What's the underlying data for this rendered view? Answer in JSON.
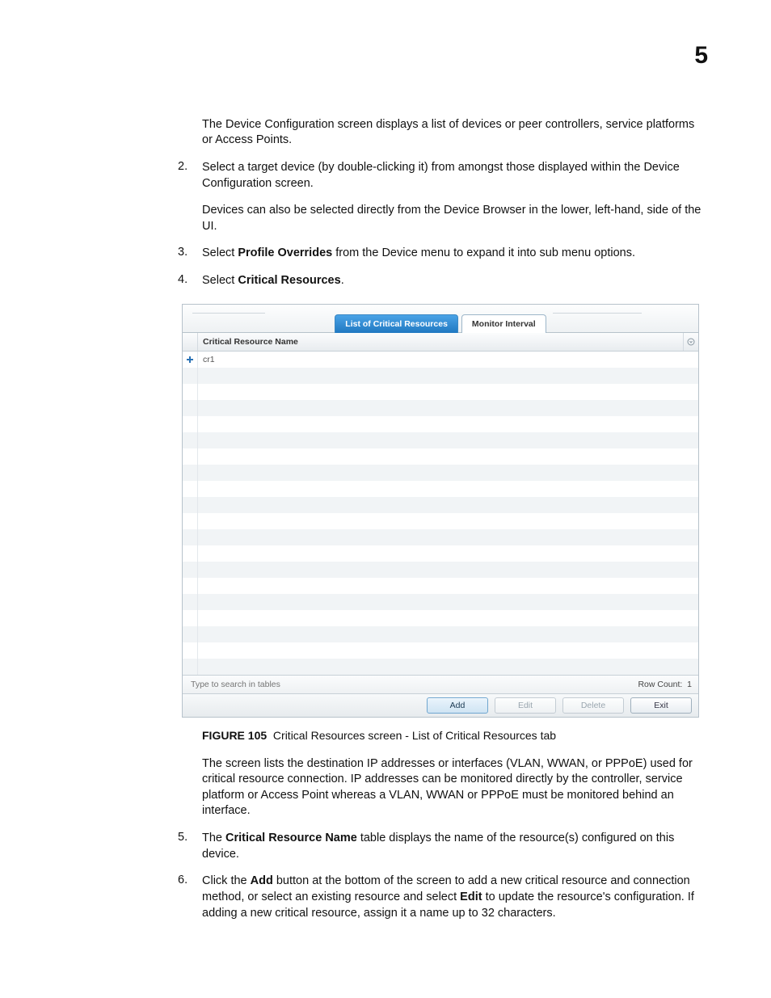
{
  "page_number": "5",
  "paragraphs": {
    "intro": "The Device Configuration screen displays a list of devices or peer controllers, service platforms or Access Points.",
    "step2": "Select a target device (by double-clicking it) from amongst those displayed within the Device Configuration screen.",
    "step2b": "Devices can also be selected directly from the Device Browser in the lower, left-hand, side of the UI.",
    "step3_pre": "Select ",
    "step3_bold": "Profile Overrides",
    "step3_post": " from the Device menu to expand it into sub menu options.",
    "step4_pre": "Select ",
    "step4_bold": "Critical Resources",
    "step4_post": ".",
    "after_fig": "The screen lists the destination IP addresses or interfaces (VLAN, WWAN, or PPPoE) used for critical resource connection. IP addresses can be monitored directly by the controller, service platform or Access Point whereas a VLAN, WWAN or PPPoE must be monitored behind an interface.",
    "step5_pre": "The ",
    "step5_bold": "Critical Resource Name",
    "step5_post": " table displays the name of the resource(s) configured on this device.",
    "step6_pre": "Click the ",
    "step6_bold1": "Add",
    "step6_mid": " button at the bottom of the screen to add a new critical resource and connection method, or select an existing resource and select ",
    "step6_bold2": "Edit",
    "step6_post": " to update the resource's configuration. If adding a new critical resource, assign it a name up to 32 characters."
  },
  "list_numbers": {
    "n2": "2.",
    "n3": "3.",
    "n4": "4.",
    "n5": "5.",
    "n6": "6."
  },
  "figure": {
    "label": "FIGURE 105",
    "caption": "Critical Resources screen - List of Critical Resources tab"
  },
  "app": {
    "tabs": {
      "active": "List of Critical Resources",
      "inactive": "Monitor Interval"
    },
    "column_header": "Critical Resource Name",
    "rows": [
      {
        "name": "cr1"
      }
    ],
    "search_placeholder": "Type to search in tables",
    "row_count_label": "Row Count:",
    "row_count_value": "1",
    "buttons": {
      "add": "Add",
      "edit": "Edit",
      "delete": "Delete",
      "exit": "Exit"
    }
  }
}
